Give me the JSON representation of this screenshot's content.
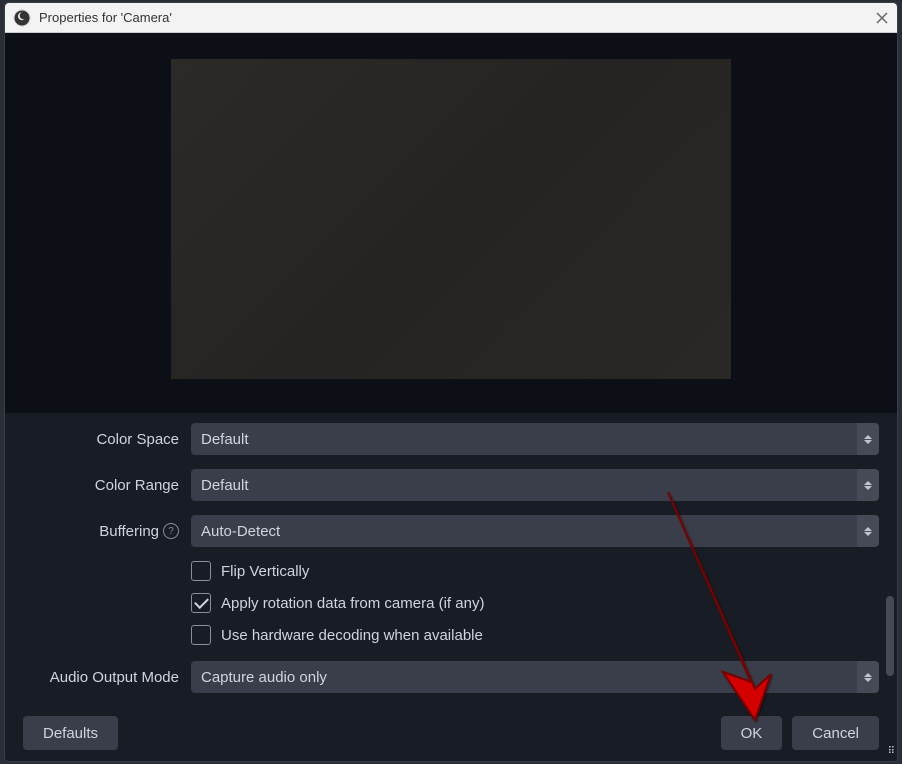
{
  "title": "Properties for 'Camera'",
  "form": {
    "color_space": {
      "label": "Color Space",
      "value": "Default"
    },
    "color_range": {
      "label": "Color Range",
      "value": "Default"
    },
    "buffering": {
      "label": "Buffering",
      "value": "Auto-Detect"
    },
    "flip_vertically": {
      "label": "Flip Vertically",
      "checked": false
    },
    "apply_rotation": {
      "label": "Apply rotation data from camera (if any)",
      "checked": true
    },
    "hardware_decode": {
      "label": "Use hardware decoding when available",
      "checked": false
    },
    "audio_output_mode": {
      "label": "Audio Output Mode",
      "value": "Capture audio only"
    }
  },
  "buttons": {
    "defaults": "Defaults",
    "ok": "OK",
    "cancel": "Cancel"
  }
}
